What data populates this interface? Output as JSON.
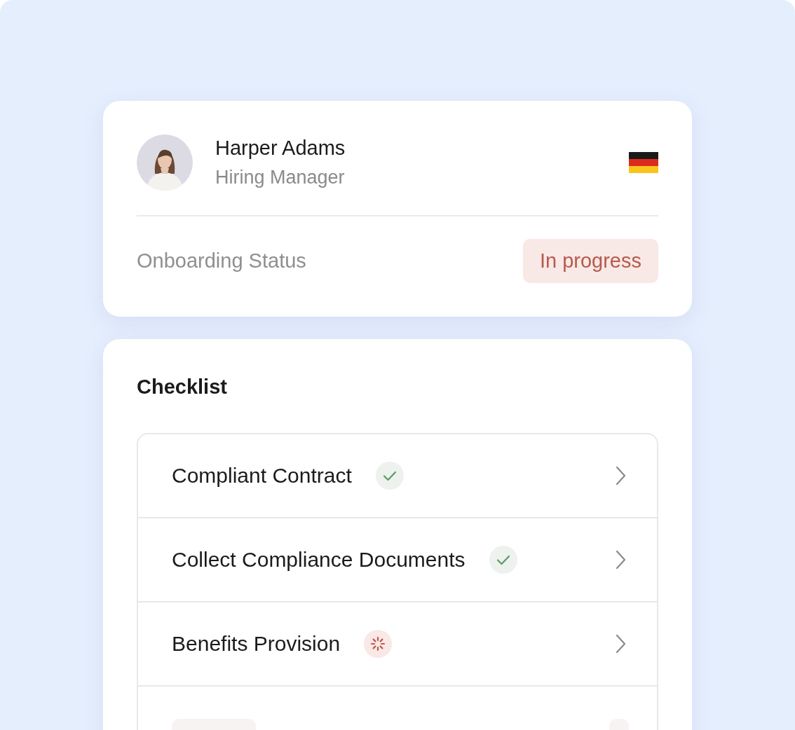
{
  "profile": {
    "name": "Harper Adams",
    "role": "Hiring Manager",
    "status_label": "Onboarding Status",
    "status_badge": "In progress"
  },
  "checklist": {
    "title": "Checklist",
    "items": [
      {
        "kind": "done",
        "label": "Compliant Contract"
      },
      {
        "kind": "done",
        "label": "Collect Compliance Documents"
      },
      {
        "kind": "pending",
        "label": "Benefits Provision"
      },
      {
        "kind": "skeleton"
      }
    ]
  }
}
